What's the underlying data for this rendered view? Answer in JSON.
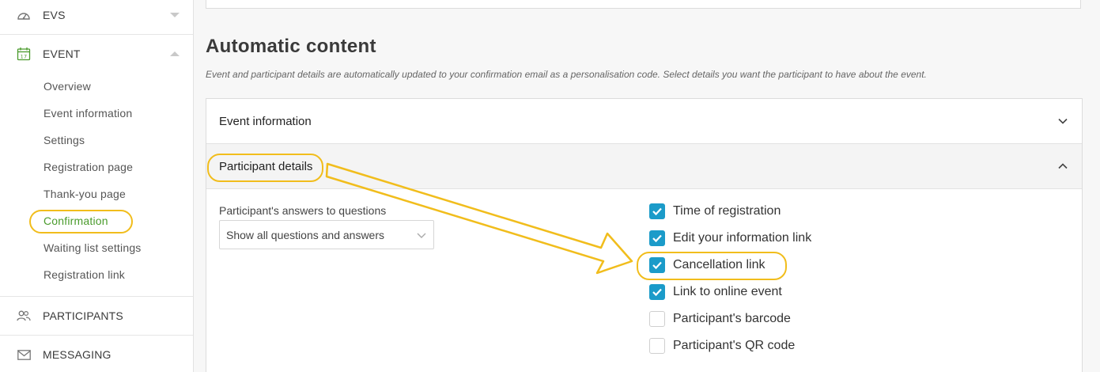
{
  "sidebar": {
    "sections": [
      {
        "label": "EVS",
        "icon": "dashboard-icon"
      },
      {
        "label": "EVENT",
        "icon": "calendar-icon"
      },
      {
        "label": "PARTICIPANTS",
        "icon": "users-icon"
      },
      {
        "label": "MESSAGING",
        "icon": "mail-icon"
      }
    ],
    "event_items": [
      {
        "label": "Overview"
      },
      {
        "label": "Event information"
      },
      {
        "label": "Settings"
      },
      {
        "label": "Registration page"
      },
      {
        "label": "Thank-you page"
      },
      {
        "label": "Confirmation",
        "active": true
      },
      {
        "label": "Waiting list settings"
      },
      {
        "label": "Registration link"
      }
    ],
    "calendar_day": "17"
  },
  "main": {
    "title": "Automatic content",
    "description": "Event and participant details are automatically updated to your confirmation email as a personalisation code. Select details you want the participant to have about the event.",
    "accordion": [
      {
        "label": "Event information",
        "expanded": false
      },
      {
        "label": "Participant details",
        "expanded": true
      }
    ],
    "question_label": "Participant's answers to questions",
    "question_select": "Show all questions and answers",
    "checkboxes": [
      {
        "label": "Time of registration",
        "checked": true
      },
      {
        "label": "Edit your information link",
        "checked": true
      },
      {
        "label": "Cancellation link",
        "checked": true
      },
      {
        "label": "Link to online event",
        "checked": true
      },
      {
        "label": "Participant's barcode",
        "checked": false
      },
      {
        "label": "Participant's QR code",
        "checked": false
      }
    ]
  },
  "colors": {
    "accent_green": "#4a9b2c",
    "checkbox_blue": "#1b9bc9",
    "highlight_yellow": "#f1bd1c"
  }
}
